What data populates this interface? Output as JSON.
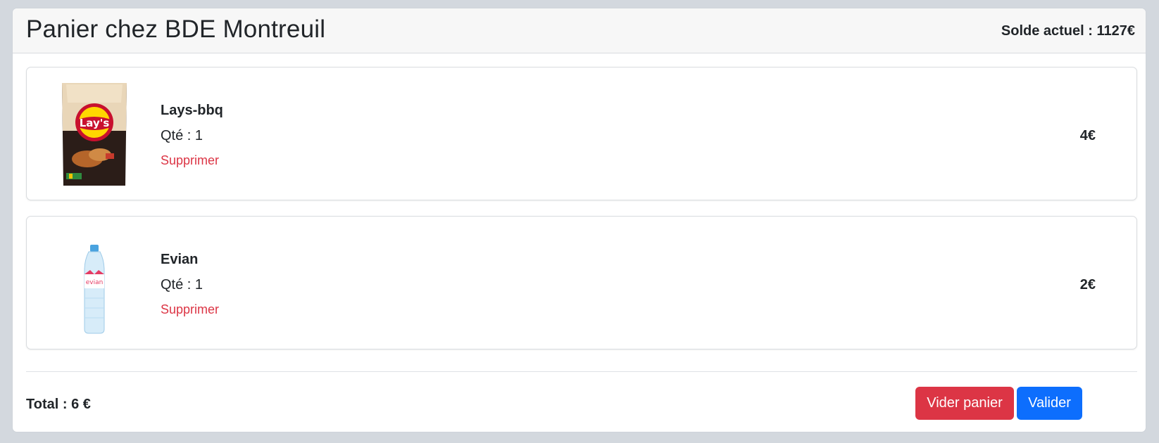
{
  "header": {
    "title": "Panier chez BDE Montreuil",
    "balance": "Solde actuel : 1127€"
  },
  "items": [
    {
      "name": "Lays-bbq",
      "qty": "Qté : 1",
      "remove_label": "Supprimer",
      "price": "4€",
      "image": "lays-bbq-chips-bag",
      "image_text": "Lay's"
    },
    {
      "name": "Evian",
      "qty": "Qté : 1",
      "remove_label": "Supprimer",
      "price": "2€",
      "image": "evian-water-bottle",
      "image_text": "evian"
    }
  ],
  "footer": {
    "total": "Total : 6 €",
    "clear_label": "Vider panier",
    "validate_label": "Valider"
  },
  "colors": {
    "danger": "#dc3545",
    "primary": "#0d6efd",
    "page_bg": "#d3d8de"
  }
}
